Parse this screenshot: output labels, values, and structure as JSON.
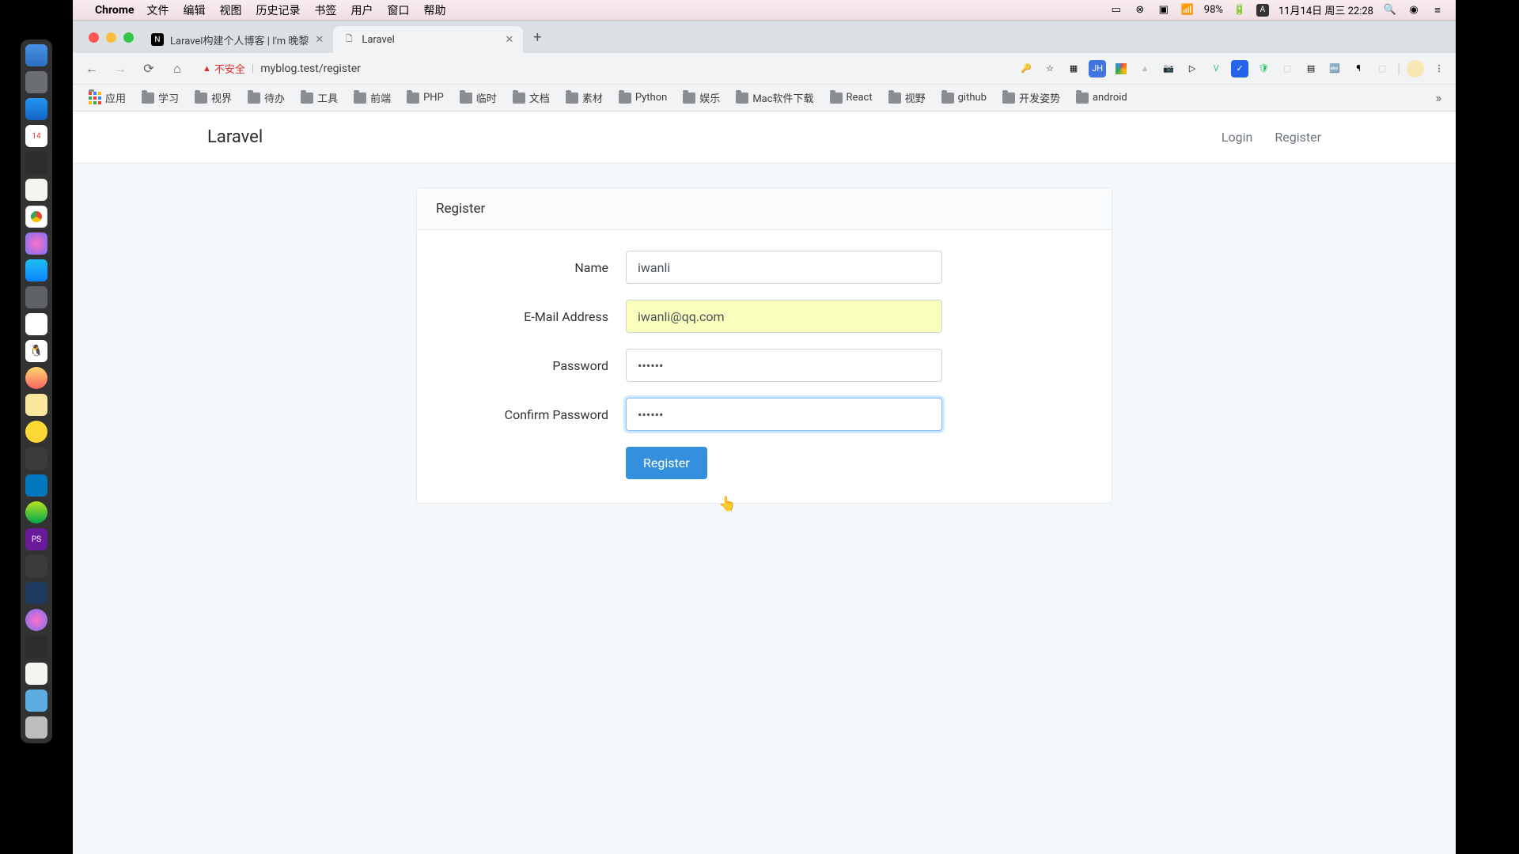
{
  "menubar": {
    "app": "Chrome",
    "items": [
      "文件",
      "编辑",
      "视图",
      "历史记录",
      "书签",
      "用户",
      "窗口",
      "帮助"
    ],
    "battery_pct": "98%",
    "datetime": "11月14日 周三 22:28"
  },
  "tabs": [
    {
      "title": "Laravel构建个人博客 | I'm 晚黎",
      "active": false
    },
    {
      "title": "Laravel",
      "active": true
    }
  ],
  "address": {
    "insecure_label": "不安全",
    "url": "myblog.test/register"
  },
  "bookmarks": [
    "应用",
    "学习",
    "视界",
    "待办",
    "工具",
    "前端",
    "PHP",
    "临时",
    "文档",
    "素材",
    "Python",
    "娱乐",
    "Mac软件下载",
    "React",
    "视野",
    "github",
    "开发姿势",
    "android"
  ],
  "nav": {
    "brand": "Laravel",
    "login": "Login",
    "register": "Register"
  },
  "form": {
    "card_title": "Register",
    "name_label": "Name",
    "name_value": "iwanli",
    "email_label": "E-Mail Address",
    "email_value": "iwanli@qq.com",
    "password_label": "Password",
    "password_value": "••••••",
    "confirm_label": "Confirm Password",
    "confirm_value": "••••••",
    "submit_label": "Register"
  }
}
